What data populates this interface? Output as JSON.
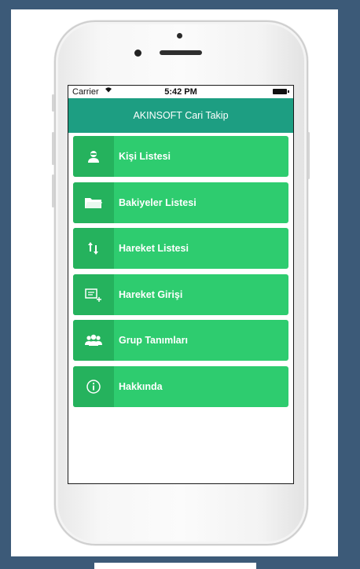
{
  "status_bar": {
    "carrier": "Carrier",
    "time": "5:42 PM"
  },
  "app": {
    "title": "AKINSOFT Cari Takip"
  },
  "menu": [
    {
      "label": "Kişi Listesi",
      "icon": "person-icon"
    },
    {
      "label": "Bakiyeler Listesi",
      "icon": "folder-icon"
    },
    {
      "label": "Hareket Listesi",
      "icon": "arrows-updown-icon"
    },
    {
      "label": "Hareket Girişi",
      "icon": "add-entry-icon"
    },
    {
      "label": "Grup Tanımları",
      "icon": "group-icon"
    },
    {
      "label": "Hakkında",
      "icon": "info-icon"
    }
  ],
  "colors": {
    "nav": "#1d9e82",
    "item": "#2ecc6f",
    "icon_bg": "#25b25d",
    "frame": "#3c5a78"
  }
}
